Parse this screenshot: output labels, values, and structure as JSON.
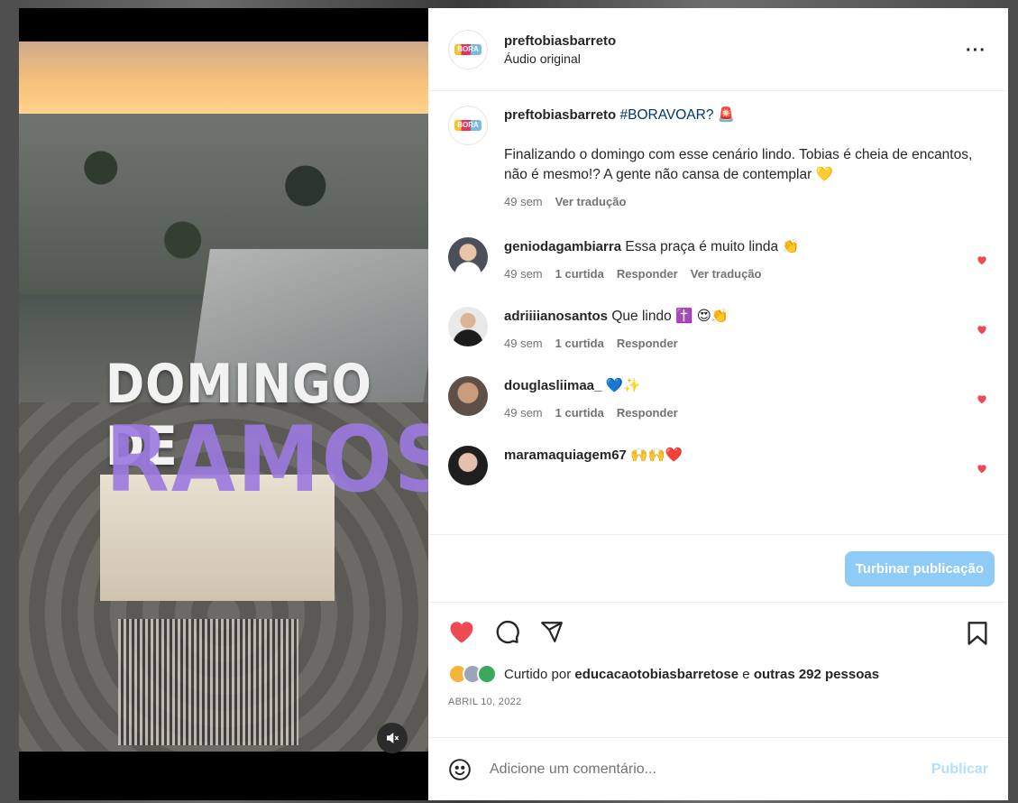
{
  "post": {
    "username": "preftobiasbarreto",
    "audio": "Áudio original",
    "more": "···",
    "logo_text": "BORA"
  },
  "video": {
    "overlay_line1": "DOMINGO DE",
    "overlay_line2": "RAMOS"
  },
  "caption": {
    "username": "preftobiasbarreto",
    "hashtag": "#BORAVOAR?",
    "emoji": "🚨",
    "text": "Finalizando o domingo com esse cenário lindo. Tobias é cheia de encantos, não é mesmo!? A gente não cansa de contemplar 💛",
    "time": "49 sem",
    "translate": "Ver tradução"
  },
  "comments": [
    {
      "username": "geniodagambiarra",
      "text": "Essa praça é muito linda 👏",
      "time": "49 sem",
      "likes": "1 curtida",
      "reply": "Responder",
      "translate": "Ver tradução",
      "avatar_color": "#4b4f5a"
    },
    {
      "username": "adriiiianosantos",
      "text": "Que lindo ✝️ 😍👏",
      "time": "49 sem",
      "likes": "1 curtida",
      "reply": "Responder",
      "translate": "",
      "avatar_color": "#3a3a3a"
    },
    {
      "username": "douglasliimaa_",
      "text": "💙✨",
      "time": "49 sem",
      "likes": "1 curtida",
      "reply": "Responder",
      "translate": "",
      "avatar_color": "#8a6a55"
    },
    {
      "username": "maramaquiagem67",
      "text": "🙌🙌❤️",
      "time": "",
      "likes": "",
      "reply": "",
      "translate": "",
      "avatar_color": "#2c2c2c"
    }
  ],
  "boost_label": "Turbinar publicação",
  "likes": {
    "prefix": "Curtido por",
    "user": "educacaotobiasbarretose",
    "connector": "e",
    "others": "outras 292 pessoas"
  },
  "date": "ABRIL 10, 2022",
  "add_comment": {
    "placeholder": "Adicione um comentário...",
    "publish": "Publicar"
  },
  "colors": {
    "like_red": "#ed4956",
    "link_blue": "#00376b",
    "boost_blue": "#8fcbf7",
    "publish_disabled": "#b2dffc"
  }
}
